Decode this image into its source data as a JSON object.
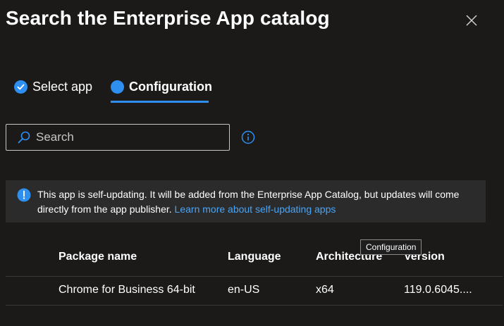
{
  "dialog": {
    "title": "Search the Enterprise App catalog",
    "close_icon": "close-icon"
  },
  "wizard": {
    "tabs": [
      {
        "label": "Select app",
        "icon": "checkmark-circle-icon",
        "state": "completed"
      },
      {
        "label": "Configuration",
        "icon": "filled-circle-icon",
        "state": "active"
      }
    ],
    "accent": "#2f8ff0"
  },
  "search": {
    "placeholder": "Search",
    "value": ""
  },
  "banner": {
    "icon": "info-filled-icon",
    "text": "This app is self-updating. It will be added from the Enterprise App Catalog, but updates will come directly from the app publisher.",
    "link": "Learn more about self-updating apps",
    "link_color": "#4aa4f6"
  },
  "tooltip": {
    "text": "Configuration"
  },
  "table": {
    "columns": [
      "Package name",
      "Language",
      "Architecture",
      "Version"
    ],
    "rows": [
      [
        "Chrome for Business 64-bit",
        "en-US",
        "x64",
        "119.0.6045...."
      ]
    ]
  }
}
